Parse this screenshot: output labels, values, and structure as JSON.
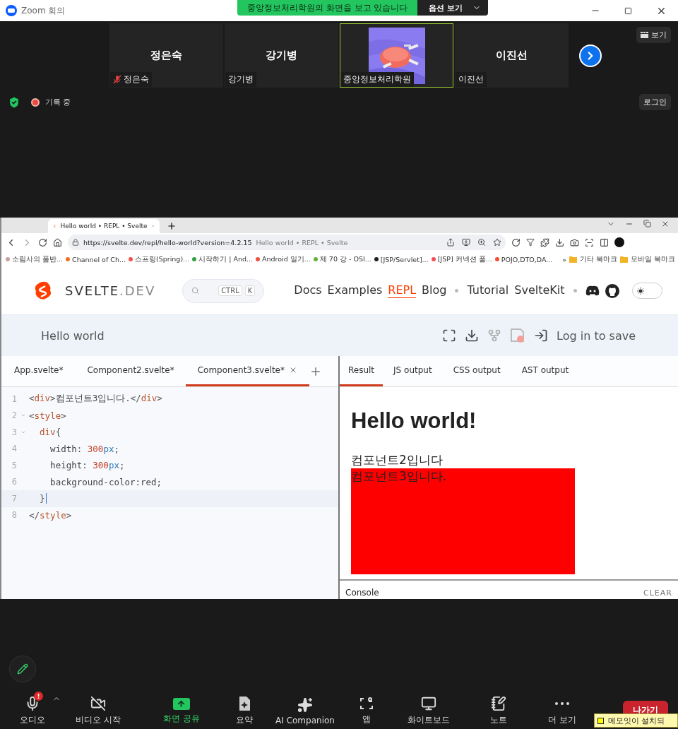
{
  "window": {
    "title": "Zoom 회의"
  },
  "share_banner": {
    "text": "중앙정보처리학원의 화면을 보고 있습니다",
    "options": "옵션 보기"
  },
  "participants": [
    {
      "kind": "name",
      "name": "정은숙",
      "label": "정은숙",
      "muted": true,
      "selected": false
    },
    {
      "kind": "name",
      "name": "강기병",
      "label": "강기병",
      "muted": false,
      "selected": false
    },
    {
      "kind": "picture",
      "label": "중앙정보처리학원",
      "muted": false,
      "selected": true
    },
    {
      "kind": "name",
      "name": "이진선",
      "label": "이진선",
      "muted": false,
      "selected": false
    }
  ],
  "view_button": "보기",
  "recording": "기록 중",
  "login": "로그인",
  "browser": {
    "tab_title": "Hello world • REPL • Svelte",
    "url": "https://svelte.dev/repl/hello-world?version=4.2.15",
    "page_title": "Hello world • REPL • Svelte",
    "bookmarks": [
      {
        "label": "소림사의 품반...",
        "color": "#c9a0a0"
      },
      {
        "label": "Channel of Ch...",
        "color": "#f07020"
      },
      {
        "label": "스프링(Spring)...",
        "color": "#f05050"
      },
      {
        "label": "시작하기 | And...",
        "color": "#30a040"
      },
      {
        "label": "Android 일기...",
        "color": "#f05040"
      },
      {
        "label": "제 70 강 - OSI...",
        "color": "#60b040"
      },
      {
        "label": "[JSP/Servlet]...",
        "color": "#202020"
      },
      {
        "label": "[JSP] 커넥션 풀...",
        "color": "#f05058"
      },
      {
        "label": "POJO,DTO,DA...",
        "color": "#f05030"
      }
    ],
    "bookmark_more": "»",
    "folders": [
      "기타 북마크",
      "모바일 북마크"
    ]
  },
  "svelte": {
    "logo_main": "SVELTE",
    "logo_suffix": ".DEV",
    "search_keys": [
      "CTRL",
      "K"
    ],
    "dark_theme": false,
    "nav_groups": [
      [
        {
          "label": "Docs",
          "selected": false
        },
        {
          "label": "Examples",
          "selected": false
        },
        {
          "label": "REPL",
          "selected": true
        },
        {
          "label": "Blog",
          "selected": false
        }
      ],
      [
        {
          "label": "Tutorial",
          "selected": false
        },
        {
          "label": "SvelteKit",
          "selected": false
        }
      ]
    ]
  },
  "repl": {
    "title": "Hello world",
    "save": "Log in to save",
    "files": [
      {
        "name": "App.svelte*",
        "selected": false
      },
      {
        "name": "Component2.svelte*",
        "selected": false
      },
      {
        "name": "Component3.svelte*",
        "selected": true
      }
    ],
    "output_tabs": [
      {
        "label": "Result",
        "selected": true
      },
      {
        "label": "JS output",
        "selected": false
      },
      {
        "label": "CSS output",
        "selected": false
      },
      {
        "label": "AST output",
        "selected": false
      }
    ],
    "code": [
      {
        "number": "1",
        "foldable": false,
        "active": false,
        "tokens": [
          {
            "kind": "p",
            "text": "<"
          },
          {
            "kind": "tag",
            "text": "div"
          },
          {
            "kind": "p",
            "text": ">"
          },
          {
            "kind": "txt",
            "text": "컴포넌트3입니다."
          },
          {
            "kind": "p",
            "text": "</"
          },
          {
            "kind": "tag",
            "text": "div"
          },
          {
            "kind": "p",
            "text": ">"
          }
        ]
      },
      {
        "number": "2",
        "foldable": true,
        "active": false,
        "tokens": [
          {
            "kind": "p",
            "text": "<"
          },
          {
            "kind": "tag",
            "text": "style"
          },
          {
            "kind": "p",
            "text": ">"
          }
        ]
      },
      {
        "number": "3",
        "foldable": true,
        "active": false,
        "tokens": [
          {
            "kind": "tag",
            "text": "  div"
          },
          {
            "kind": "p",
            "text": "{"
          }
        ]
      },
      {
        "number": "4",
        "foldable": false,
        "active": false,
        "tokens": [
          {
            "kind": "txt",
            "text": "    width: "
          },
          {
            "kind": "num",
            "text": "300"
          },
          {
            "kind": "unit",
            "text": "px"
          },
          {
            "kind": "p",
            "text": ";"
          }
        ]
      },
      {
        "number": "5",
        "foldable": false,
        "active": false,
        "tokens": [
          {
            "kind": "txt",
            "text": "    height: "
          },
          {
            "kind": "num",
            "text": "300"
          },
          {
            "kind": "unit",
            "text": "px"
          },
          {
            "kind": "p",
            "text": ";"
          }
        ]
      },
      {
        "number": "6",
        "foldable": false,
        "active": false,
        "tokens": [
          {
            "kind": "txt",
            "text": "    background-color:red;"
          }
        ]
      },
      {
        "number": "7",
        "foldable": false,
        "active": true,
        "tokens": [
          {
            "kind": "p",
            "text": "  }"
          }
        ]
      },
      {
        "number": "8",
        "foldable": false,
        "active": false,
        "tokens": [
          {
            "kind": "p",
            "text": "</"
          },
          {
            "kind": "tag",
            "text": "style"
          },
          {
            "kind": "p",
            "text": ">"
          }
        ]
      }
    ],
    "result": {
      "heading": "Hello world!",
      "text": "컴포넌트2입니다",
      "box_text": "컴포넌트3입니다."
    },
    "console": "Console",
    "clear": "CLEAR"
  },
  "toolbar": [
    {
      "kind": "mic",
      "label": "오디오",
      "alert": "!",
      "accent": false
    },
    {
      "kind": "video-off",
      "label": "비디오 시작",
      "accent": false
    },
    {
      "kind": "share",
      "label": "화면 공유",
      "accent": true
    },
    {
      "kind": "summary",
      "label": "요약",
      "accent": false
    },
    {
      "kind": "ai",
      "label": "AI Companion",
      "accent": false
    },
    {
      "kind": "apps",
      "label": "앱",
      "accent": false
    },
    {
      "kind": "whiteboard",
      "label": "화이트보드",
      "accent": false
    },
    {
      "kind": "notes",
      "label": "노트",
      "accent": false
    },
    {
      "kind": "more",
      "label": "더 보기",
      "accent": false
    }
  ],
  "leave": "나가기",
  "notice": "메모잇이 설치되"
}
